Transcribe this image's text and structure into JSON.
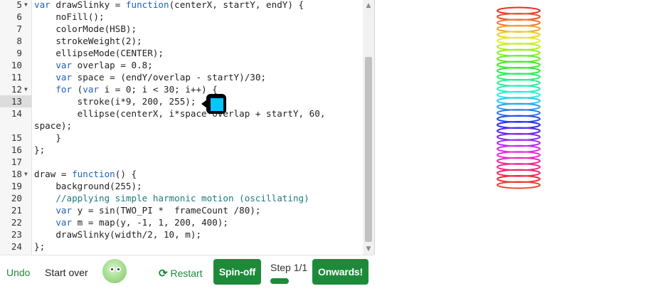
{
  "editor": {
    "lines": [
      {
        "num": "5",
        "fold": true,
        "segments": [
          {
            "t": "var",
            "c": "kw"
          },
          {
            "t": " drawSlinky = "
          },
          {
            "t": "function",
            "c": "kw"
          },
          {
            "t": "(centerX, startY, endY) {"
          }
        ]
      },
      {
        "num": "6",
        "segments": [
          {
            "t": "    noFill();"
          }
        ]
      },
      {
        "num": "7",
        "segments": [
          {
            "t": "    colorMode(HSB);"
          }
        ]
      },
      {
        "num": "8",
        "segments": [
          {
            "t": "    strokeWeight(2);"
          }
        ]
      },
      {
        "num": "9",
        "segments": [
          {
            "t": "    ellipseMode(CENTER);"
          }
        ]
      },
      {
        "num": "10",
        "segments": [
          {
            "t": "    "
          },
          {
            "t": "var",
            "c": "kw"
          },
          {
            "t": " overlap = 0.8;"
          }
        ]
      },
      {
        "num": "11",
        "segments": [
          {
            "t": "    "
          },
          {
            "t": "var",
            "c": "kw"
          },
          {
            "t": " space = (endY/overlap - startY)/30;"
          }
        ]
      },
      {
        "num": "12",
        "fold": true,
        "segments": [
          {
            "t": "    "
          },
          {
            "t": "for",
            "c": "kw"
          },
          {
            "t": " ("
          },
          {
            "t": "var",
            "c": "kw"
          },
          {
            "t": " i = 0; i < 30; i++) {"
          }
        ]
      },
      {
        "num": "13",
        "active": true,
        "segments": [
          {
            "t": "        stroke(i*9, 200, 255);"
          }
        ]
      },
      {
        "num": "14",
        "segments": [
          {
            "t": "        ellipse(centerX, i*space*overlap + startY, 60,"
          }
        ]
      },
      {
        "num": "",
        "segments": [
          {
            "t": "space);"
          }
        ],
        "wrapped": true
      },
      {
        "num": "15",
        "segments": [
          {
            "t": "    }"
          }
        ]
      },
      {
        "num": "16",
        "segments": [
          {
            "t": "};"
          }
        ]
      },
      {
        "num": "17",
        "segments": [
          {
            "t": ""
          }
        ]
      },
      {
        "num": "18",
        "fold": true,
        "segments": [
          {
            "t": "draw = "
          },
          {
            "t": "function",
            "c": "kw"
          },
          {
            "t": "() {"
          }
        ]
      },
      {
        "num": "19",
        "segments": [
          {
            "t": "    background(255);"
          }
        ]
      },
      {
        "num": "20",
        "segments": [
          {
            "t": "    "
          },
          {
            "t": "//applying simple harmonic motion (oscillating)",
            "c": "cm"
          }
        ]
      },
      {
        "num": "21",
        "segments": [
          {
            "t": "    "
          },
          {
            "t": "var",
            "c": "kw"
          },
          {
            "t": " y = sin(TWO_PI *  frameCount /80);"
          }
        ]
      },
      {
        "num": "22",
        "segments": [
          {
            "t": "    "
          },
          {
            "t": "var",
            "c": "kw"
          },
          {
            "t": " m = map(y, -1, 1, 200, 400);"
          }
        ]
      },
      {
        "num": "23",
        "segments": [
          {
            "t": "    drawSlinky(width/2, 10, m);"
          }
        ]
      },
      {
        "num": "24",
        "segments": [
          {
            "t": "};"
          }
        ]
      }
    ]
  },
  "color_picker": {
    "swatch_color": "#00c8ff"
  },
  "slinky": {
    "rings": 30
  },
  "bottom_bar": {
    "undo": "Undo",
    "start_over": "Start over",
    "restart": "Restart",
    "spin_off": "Spin-off",
    "step": "Step 1/1",
    "onwards": "Onwards!"
  },
  "colors": {
    "accent_green": "#1d8a3a",
    "link_green": "#1d8a3a",
    "keyword_blue": "#1f5fbf"
  }
}
